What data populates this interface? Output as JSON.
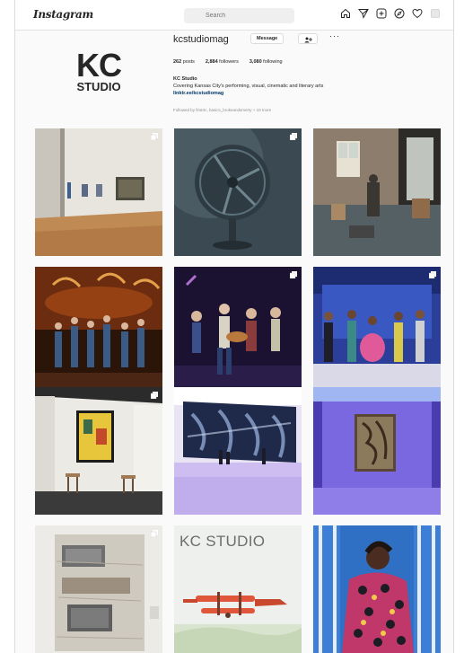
{
  "window": {
    "width": 517,
    "height": 727
  },
  "topnav": {
    "logo_text": "Instagram",
    "logo_caret": "⌄",
    "search_placeholder": "Search",
    "icons": [
      "home-icon",
      "direct-icon",
      "new-post-icon",
      "explore-icon",
      "activity-icon",
      "profile-icon"
    ]
  },
  "profile": {
    "logo_kc": "KC",
    "logo_studio": "STUDIO",
    "username": "kcstudiomag",
    "message_label": "Message",
    "follow_label": "+",
    "more_label": "···",
    "stats": {
      "posts_count": "262",
      "posts_label": "posts",
      "followers_count": "2,884",
      "followers_label": "followers",
      "following_count": "3,080",
      "following_label": "following"
    },
    "bio_name": "KC Studio",
    "bio_text": "Covering Kansas City's performing, visual, cinematic and literary arts",
    "bio_link": "linktr.ee/kcstudiomag",
    "followed_by": "Followed by firstrtc, basics_brokeandsmerty + 10 more"
  },
  "grid": {
    "posts": [
      {
        "name": "post-gallery-interior",
        "multi": true
      },
      {
        "name": "post-fan-sculpture",
        "multi": true
      },
      {
        "name": "post-studio-room",
        "multi": false
      },
      {
        "name": "post-stage-dancers",
        "multi": false
      },
      {
        "name": "post-stage-musicians",
        "multi": true
      },
      {
        "name": "post-stage-musical",
        "multi": true
      },
      {
        "name": "post-gallery-yellow-painting",
        "multi": true
      },
      {
        "name": "post-mural-dancers",
        "multi": false
      },
      {
        "name": "post-blue-gallery",
        "multi": false
      },
      {
        "name": "post-textile-art",
        "multi": true
      },
      {
        "name": "post-kc-studio-cover",
        "multi": false,
        "label": "KC STUDIO"
      },
      {
        "name": "post-portrait-patterned-dress",
        "multi": false
      }
    ]
  },
  "colors": {
    "accent_link": "#00376b",
    "nav_border": "#e3e3e3",
    "text": "#262626",
    "muted": "#8e8e8e"
  }
}
